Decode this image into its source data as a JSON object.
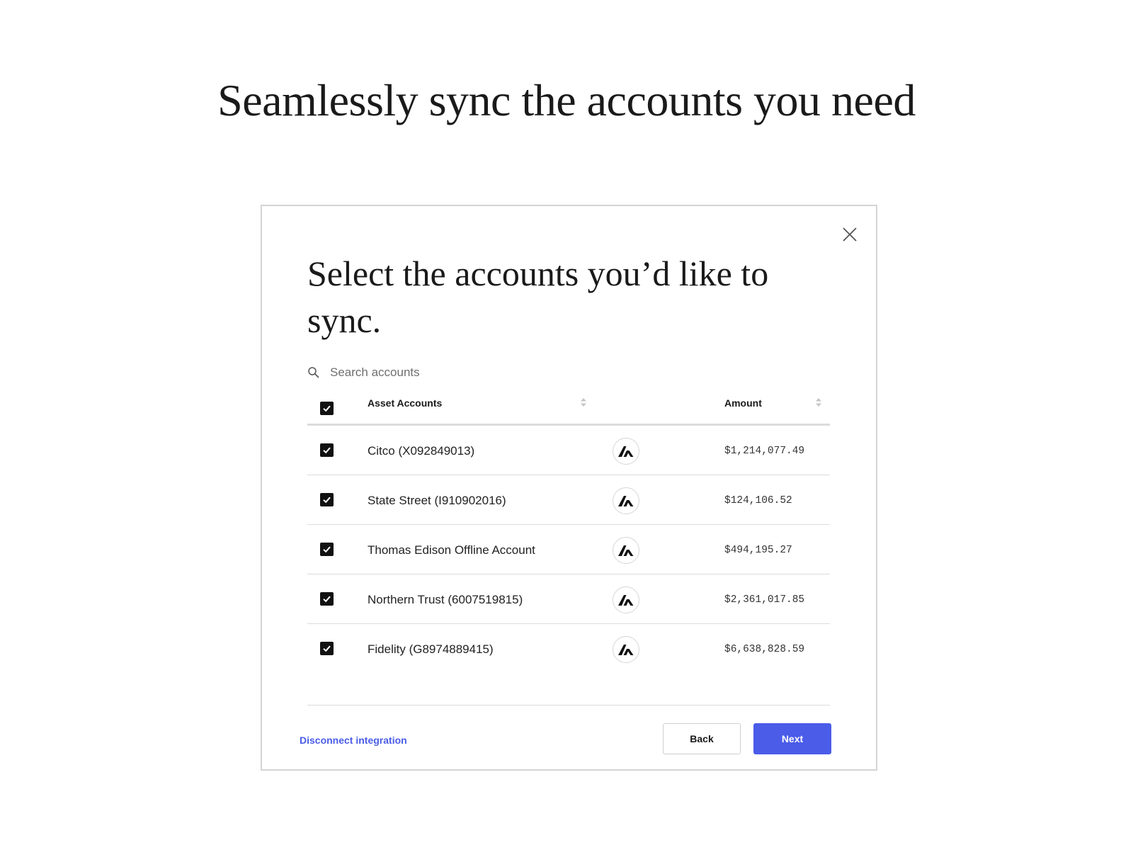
{
  "page": {
    "headline": "Seamlessly sync the accounts you need"
  },
  "modal": {
    "title": "Select the accounts you’d like to sync.",
    "search": {
      "placeholder": "Search accounts",
      "value": ""
    },
    "table": {
      "header": {
        "select_all_checked": true,
        "name_label": "Asset Accounts",
        "amount_label": "Amount"
      },
      "rows": [
        {
          "checked": true,
          "name": "Citco (X092849013)",
          "logo": "integration-logo-icon",
          "amount": "$1,214,077.49"
        },
        {
          "checked": true,
          "name": "State Street (I910902016)",
          "logo": "integration-logo-icon",
          "amount": "$124,106.52"
        },
        {
          "checked": true,
          "name": "Thomas Edison Offline Account",
          "logo": "integration-logo-icon",
          "amount": "$494,195.27"
        },
        {
          "checked": true,
          "name": "Northern Trust (6007519815)",
          "logo": "integration-logo-icon",
          "amount": "$2,361,017.85"
        },
        {
          "checked": true,
          "name": "Fidelity (G8974889415)",
          "logo": "integration-logo-icon",
          "amount": "$6,638,828.59"
        }
      ]
    },
    "footer": {
      "disconnect_label": "Disconnect integration",
      "back_label": "Back",
      "next_label": "Next"
    }
  },
  "colors": {
    "accent": "#4a5ce8",
    "checkbox": "#111111",
    "divider": "#dcdcdc"
  }
}
